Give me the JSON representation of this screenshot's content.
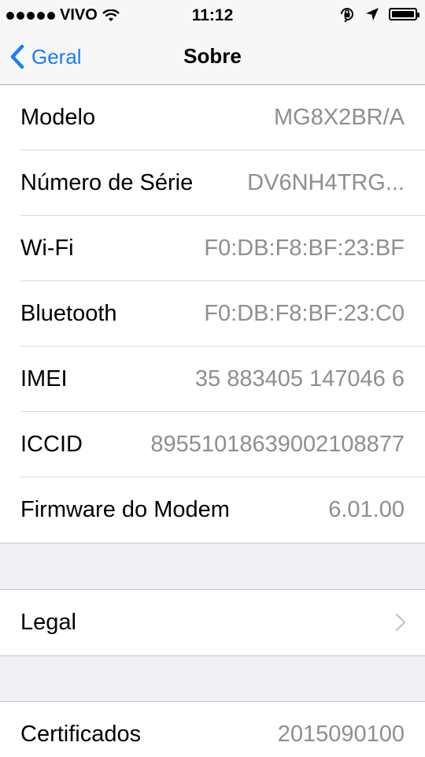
{
  "status_bar": {
    "carrier": "VIVO",
    "time": "11:12",
    "icons": [
      "signal-dots-icon",
      "wifi-icon",
      "orientation-lock-icon",
      "location-arrow-icon",
      "battery-icon"
    ],
    "battery_level": 1.0
  },
  "nav": {
    "back_label": "Geral",
    "title": "Sobre",
    "accent_color": "#1a7cf5"
  },
  "info_rows": [
    {
      "label": "Modelo",
      "value": "MG8X2BR/A"
    },
    {
      "label": "Número de Série",
      "value": "DV6NH4TRG..."
    },
    {
      "label": "Wi-Fi",
      "value": "F0:DB:F8:BF:23:BF"
    },
    {
      "label": "Bluetooth",
      "value": "F0:DB:F8:BF:23:C0"
    },
    {
      "label": "IMEI",
      "value": "35 883405 147046 6"
    },
    {
      "label": "ICCID",
      "value": "89551018639002108877"
    },
    {
      "label": "Firmware do Modem",
      "value": "6.01.00"
    }
  ],
  "legal": {
    "label": "Legal"
  },
  "certificates": {
    "label": "Certificados",
    "value": "2015090100"
  }
}
